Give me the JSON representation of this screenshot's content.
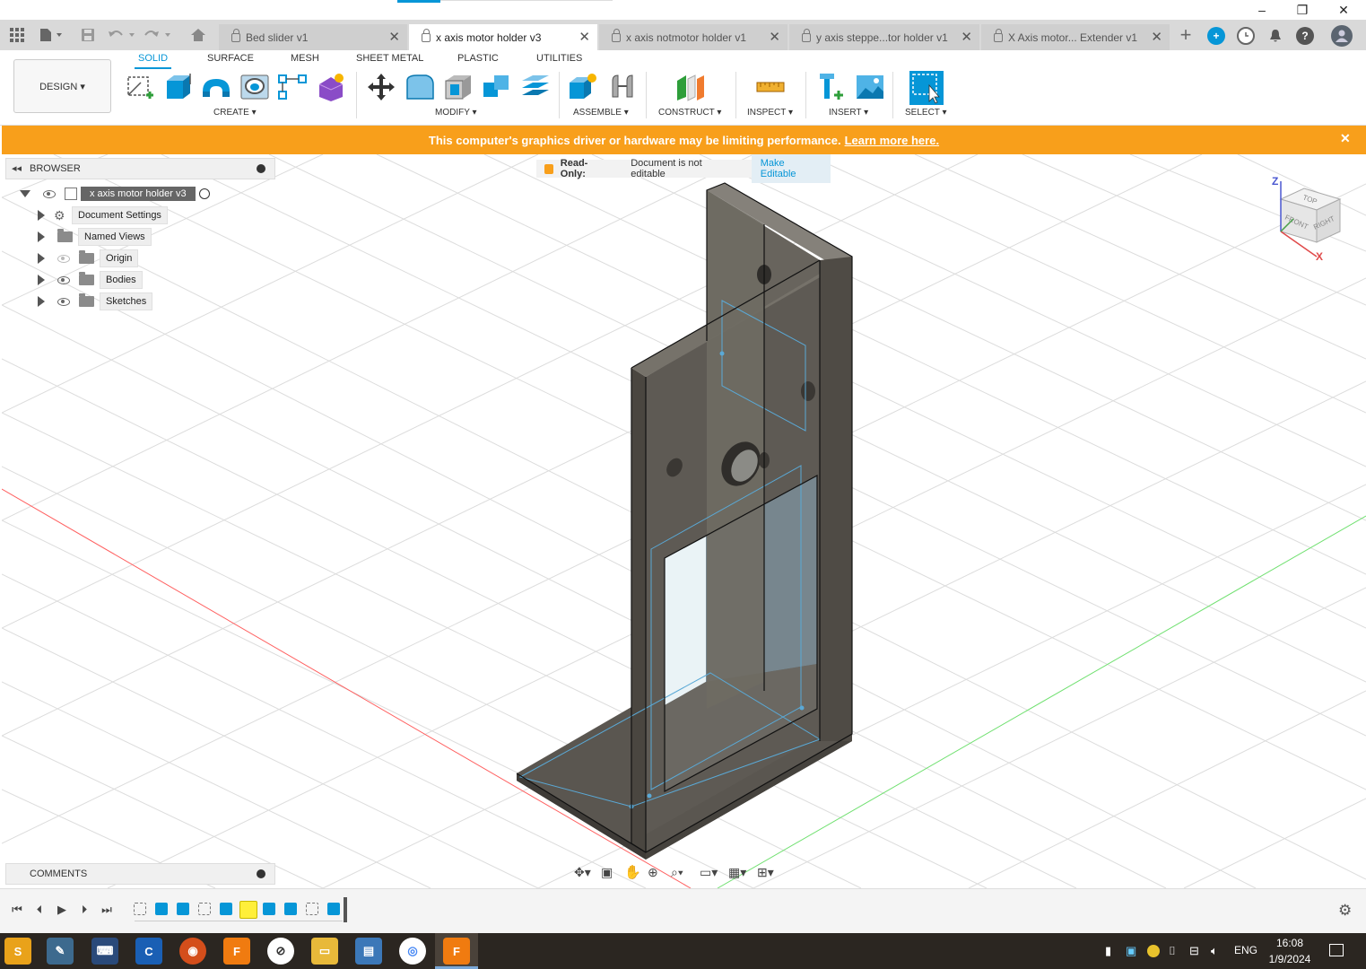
{
  "window": {
    "minimize": "–",
    "restore": "❐",
    "close": "✕"
  },
  "tabs": [
    {
      "label": "Bed slider v1",
      "active": false
    },
    {
      "label": "x axis motor holder v3",
      "active": true
    },
    {
      "label": "x axis notmotor holder v1",
      "active": false
    },
    {
      "label": "y axis steppe...tor holder v1",
      "active": false
    },
    {
      "label": "X Axis motor... Extender v1",
      "active": false
    }
  ],
  "tab_close": "✕",
  "new_tab": "+",
  "design_button": "DESIGN ▾",
  "workspace_tabs": [
    "SOLID",
    "SURFACE",
    "MESH",
    "SHEET METAL",
    "PLASTIC",
    "UTILITIES"
  ],
  "tool_groups": [
    "CREATE ▾",
    "MODIFY ▾",
    "ASSEMBLE ▾",
    "CONSTRUCT ▾",
    "INSPECT ▾",
    "INSERT ▾",
    "SELECT ▾"
  ],
  "banner": {
    "text": "This computer's graphics driver or hardware may be limiting performance.",
    "link": "Learn more here.",
    "close": "✕"
  },
  "browser": {
    "title": "BROWSER",
    "root": "x axis motor holder v3",
    "items": [
      "Document Settings",
      "Named Views",
      "Origin",
      "Bodies",
      "Sketches"
    ]
  },
  "readonly": {
    "label": "Read-Only:",
    "message": "Document is not editable",
    "action": "Make Editable"
  },
  "viewcube": {
    "top": "TOP",
    "front": "FRONT",
    "right": "RIGHT",
    "z": "Z",
    "x": "X"
  },
  "comments": {
    "title": "COMMENTS"
  },
  "taskbar": {
    "language": "ENG",
    "time": "16:08",
    "date": "1/9/2024"
  },
  "colors": {
    "accent": "#0696d7",
    "banner": "#f89f1b",
    "taskbar": "#2b2621",
    "model": "#5a5650"
  }
}
